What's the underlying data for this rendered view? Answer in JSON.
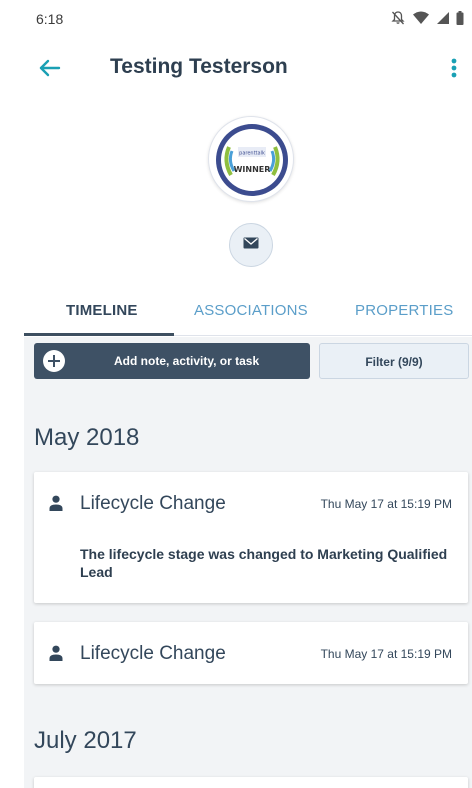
{
  "status_bar": {
    "time": "6:18",
    "icons": [
      "notifications-off-icon",
      "wifi-icon",
      "signal-icon",
      "battery-icon"
    ]
  },
  "app_bar": {
    "back_icon": "arrow-left-icon",
    "contact_name": "Testing Testerson",
    "menu_icon": "more-vertical-icon",
    "accent_color": "#1aa0b4"
  },
  "avatar": {
    "badge_text_top": "parenttalk",
    "badge_text_bottom": "WINNER"
  },
  "email_action": {
    "icon": "envelope-icon"
  },
  "tabs": [
    {
      "label": "TIMELINE",
      "active": true
    },
    {
      "label": "ASSOCIATIONS",
      "active": false
    },
    {
      "label": "PROPERTIES",
      "active": false
    }
  ],
  "actions": {
    "add_label": "Add note, activity, or task",
    "filter_label": "Filter (9/9)"
  },
  "timeline": {
    "groups": [
      {
        "month": "May 2018",
        "items": [
          {
            "title": "Lifecycle Change",
            "date": "Thu May 17 at 15:19 PM",
            "body": "The lifecycle stage was changed to Marketing Qualified Lead"
          },
          {
            "title": "Lifecycle Change",
            "date": "Thu May 17 at 15:19 PM"
          }
        ]
      },
      {
        "month": "July 2017",
        "items": []
      }
    ]
  }
}
